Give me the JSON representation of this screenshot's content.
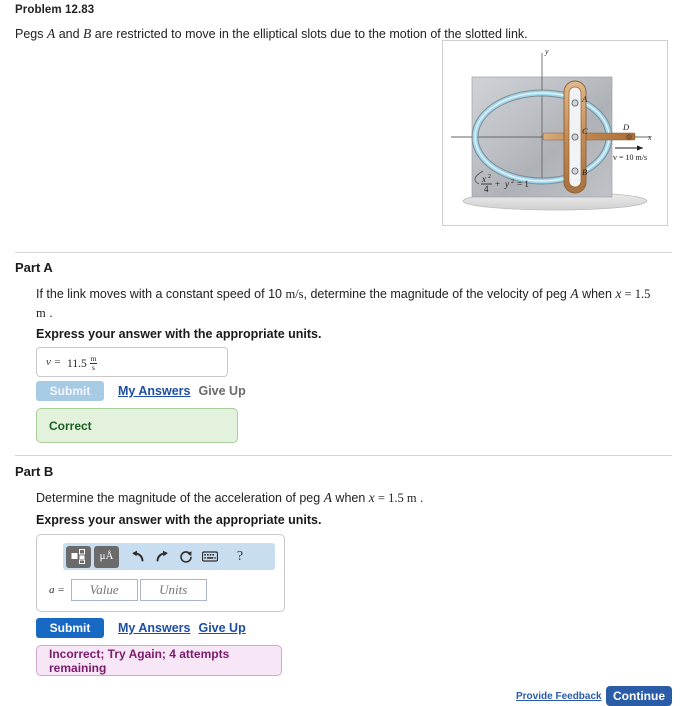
{
  "problem": {
    "title": "Problem 12.83",
    "statement_pre": "Pegs ",
    "peg_a": "A",
    "statement_mid": " and ",
    "peg_b": "B",
    "statement_post": " are restricted to move in the elliptical slots due to the motion of the slotted link."
  },
  "figure": {
    "name": "elliptical-slot-mechanism",
    "axis_y_label": "y",
    "axis_x_label": "x",
    "label_a": "A",
    "label_b": "B",
    "label_c": "C",
    "label_d": "D",
    "velocity_label": "v = 10 m/s",
    "ellipse_equation_num": "x",
    "ellipse_equation_text": "x²/4 + y² = 1",
    "eq_x2": "x",
    "eq_sup": "2",
    "eq_den": "4",
    "eq_rest": "+ y  = 1",
    "eq_y": "y",
    "eq_ysup": "2",
    "eq_tail": "= 1",
    "eq_plus": "+",
    "colors": {
      "plate": "#b9bcc0",
      "slot": "#9cd6ef",
      "link": "#c99a6a",
      "ground": "#d9d9d9"
    }
  },
  "part_a": {
    "heading": "Part A",
    "question_pre": "If the link moves with a constant speed of 10 ",
    "question_units": "m/s",
    "question_mid": ", determine the magnitude of the velocity of peg ",
    "question_peg": "A",
    "question_when": " when ",
    "question_x": "x",
    "question_val": " = 1.5 m",
    "question_end": " .",
    "express_note": "Express your answer with the appropriate units.",
    "answer_label": "v =",
    "answer_value": "11.5",
    "answer_unit_num": "m",
    "answer_unit_den": "s",
    "submit_label": "Submit",
    "my_answers_label": "My Answers",
    "give_up_label": "Give Up",
    "feedback": "Correct"
  },
  "part_b": {
    "heading": "Part B",
    "question_pre": "Determine the magnitude of the acceleration of peg ",
    "question_peg": "A",
    "question_when": " when ",
    "question_x": "x",
    "question_val": " = 1.5 m",
    "question_end": " .",
    "express_note": "Express your answer with the appropriate units.",
    "answer_label": "a =",
    "value_placeholder": "Value",
    "units_placeholder": "Units",
    "toolbar": {
      "template_icon": "template-icon",
      "units_label": "μÅ",
      "undo_icon": "⮤",
      "redo_icon": "⮥",
      "reset_icon": "↺",
      "keyboard_icon": "keyboard-icon",
      "help_label": "?"
    },
    "submit_label": "Submit",
    "my_answers_label": "My Answers",
    "give_up_label": "Give Up",
    "feedback": "Incorrect; Try Again; 4 attempts remaining"
  },
  "footer": {
    "provide_feedback": "Provide Feedback",
    "continue_label": "Continue"
  },
  "theme": {
    "link_blue": "#1d4ea3",
    "submit_blue": "#1769c4",
    "submit_disabled": "#a8cbe5",
    "correct_bg": "#e3f2dc",
    "incorrect_bg": "#f7e6f6",
    "toolbar_bg": "#c9ddf0"
  }
}
